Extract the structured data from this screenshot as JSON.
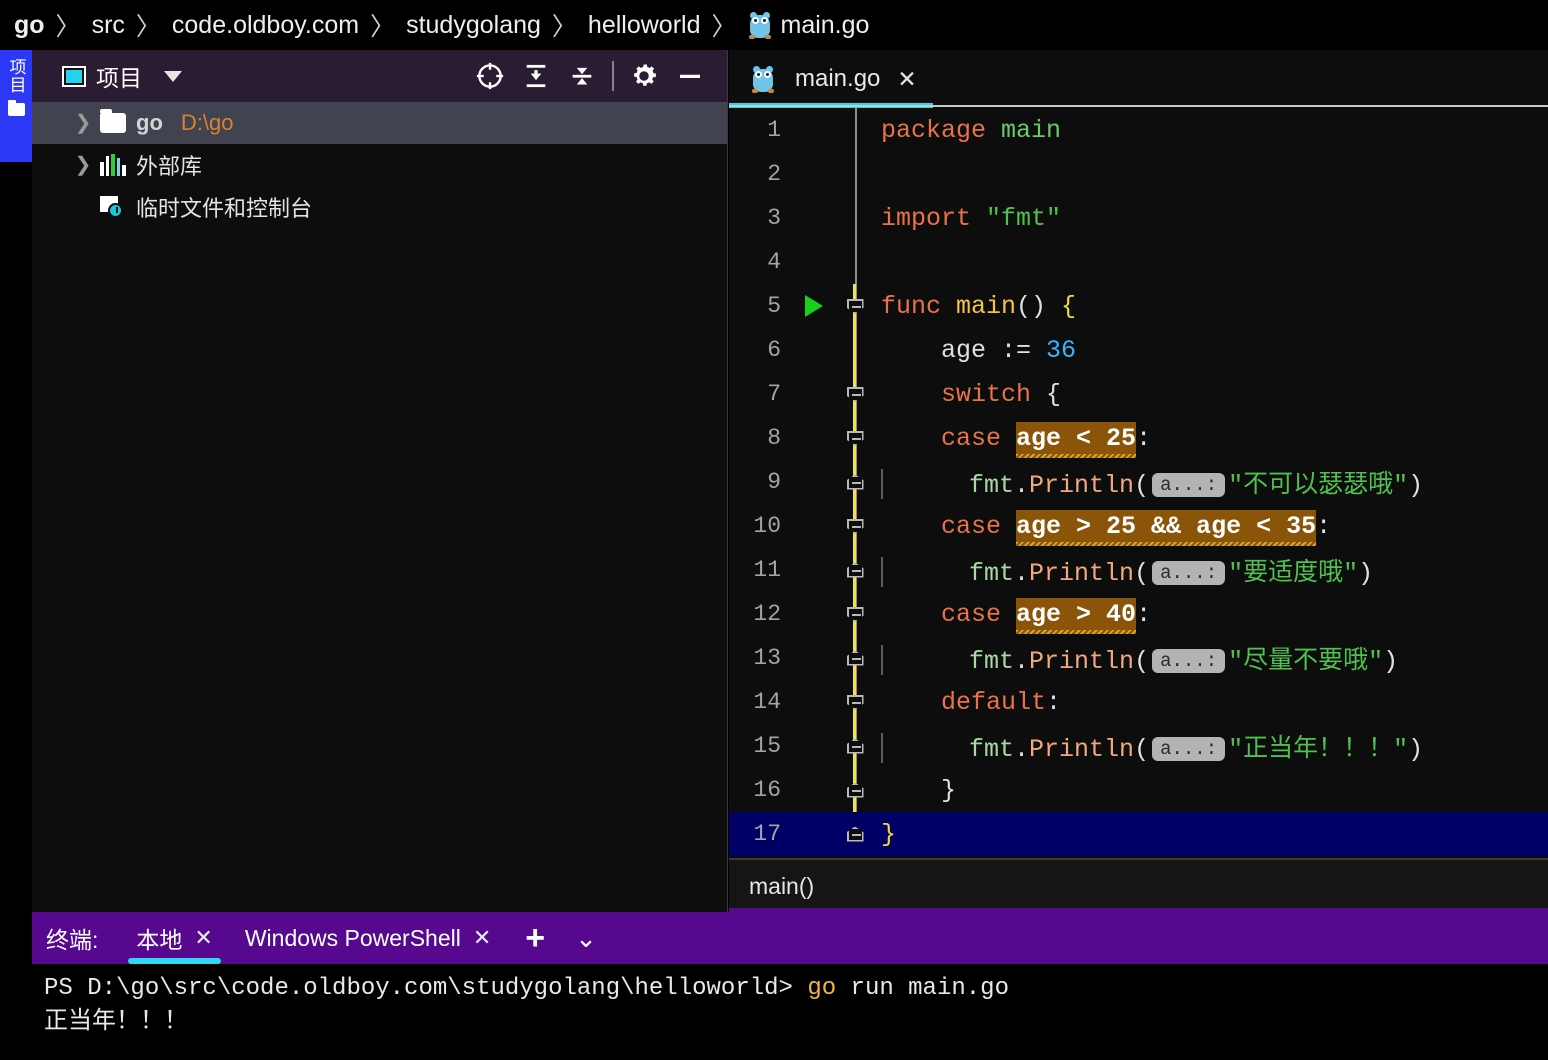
{
  "breadcrumb": {
    "items": [
      "go",
      "src",
      "code.oldboy.com",
      "studygolang",
      "helloworld",
      "main.go"
    ],
    "separator": "〉",
    "file_icon": "gopher-icon"
  },
  "rail": {
    "label": "项目",
    "folder_icon": "folder-icon",
    "accent_color": "#2b38f5"
  },
  "project_panel": {
    "title": "项目",
    "dropdown_icon": "chevron-down-icon",
    "toolbar_buttons": [
      {
        "name": "locate-icon",
        "tooltip": "定位"
      },
      {
        "name": "expand-all-icon",
        "tooltip": "全部展开"
      },
      {
        "name": "collapse-all-icon",
        "tooltip": "全部折叠"
      },
      {
        "name": "gear-icon",
        "tooltip": "设置"
      },
      {
        "name": "minimize-icon",
        "tooltip": "隐藏"
      }
    ],
    "tree": [
      {
        "label": "go",
        "path": "D:\\go",
        "icon": "folder-icon",
        "expandable": true,
        "selected": true,
        "bold": true
      },
      {
        "label": "外部库",
        "path": "",
        "icon": "library-icon",
        "expandable": true,
        "selected": false,
        "bold": false
      },
      {
        "label": "临时文件和控制台",
        "path": "",
        "icon": "scratches-icon",
        "expandable": false,
        "selected": false,
        "bold": false
      }
    ]
  },
  "editor": {
    "tab": {
      "label": "main.go",
      "icon": "gopher-icon",
      "close_icon": "close-icon",
      "active": true
    },
    "status_text": "main()",
    "current_line": 17,
    "run_marker_line": 5,
    "lines": [
      {
        "n": 1,
        "indent": 0,
        "segments": [
          {
            "t": "package ",
            "c": "kw"
          },
          {
            "t": "main",
            "c": "pkg"
          }
        ]
      },
      {
        "n": 2,
        "indent": 0,
        "segments": []
      },
      {
        "n": 3,
        "indent": 0,
        "segments": [
          {
            "t": "import ",
            "c": "kw"
          },
          {
            "t": "\"fmt\"",
            "c": "str"
          }
        ]
      },
      {
        "n": 4,
        "indent": 0,
        "segments": []
      },
      {
        "n": 5,
        "indent": 0,
        "segments": [
          {
            "t": "func ",
            "c": "kw"
          },
          {
            "t": "main",
            "c": "fn"
          },
          {
            "t": "() ",
            "c": "ident"
          },
          {
            "t": "{",
            "c": "brace"
          }
        ]
      },
      {
        "n": 6,
        "indent": 1,
        "segments": [
          {
            "t": "age := ",
            "c": "ident"
          },
          {
            "t": "36",
            "c": "num"
          }
        ]
      },
      {
        "n": 7,
        "indent": 1,
        "segments": [
          {
            "t": "switch ",
            "c": "kw"
          },
          {
            "t": "{",
            "c": "ident"
          }
        ]
      },
      {
        "n": 8,
        "indent": 1,
        "segments": [
          {
            "t": "case ",
            "c": "kw"
          },
          {
            "t": "age < 25",
            "c": "hl"
          },
          {
            "t": ":",
            "c": "ident"
          }
        ]
      },
      {
        "n": 9,
        "indent": 2,
        "segments": [
          {
            "t": "fmt",
            "c": "fmt"
          },
          {
            "t": ".",
            "c": "ident"
          },
          {
            "t": "Println",
            "c": "call"
          },
          {
            "t": "(",
            "c": "ident"
          },
          {
            "t": "a...:",
            "c": "chip"
          },
          {
            "t": "\"不可以瑟瑟哦\"",
            "c": "str"
          },
          {
            "t": ")",
            "c": "ident"
          }
        ]
      },
      {
        "n": 10,
        "indent": 1,
        "segments": [
          {
            "t": "case ",
            "c": "kw"
          },
          {
            "t": "age > 25 && age < 35",
            "c": "hl"
          },
          {
            "t": ":",
            "c": "ident"
          }
        ]
      },
      {
        "n": 11,
        "indent": 2,
        "segments": [
          {
            "t": "fmt",
            "c": "fmt"
          },
          {
            "t": ".",
            "c": "ident"
          },
          {
            "t": "Println",
            "c": "call"
          },
          {
            "t": "(",
            "c": "ident"
          },
          {
            "t": "a...:",
            "c": "chip"
          },
          {
            "t": "\"要适度哦\"",
            "c": "str"
          },
          {
            "t": ")",
            "c": "ident"
          }
        ]
      },
      {
        "n": 12,
        "indent": 1,
        "segments": [
          {
            "t": "case ",
            "c": "kw"
          },
          {
            "t": "age > 40",
            "c": "hl"
          },
          {
            "t": ":",
            "c": "ident"
          }
        ]
      },
      {
        "n": 13,
        "indent": 2,
        "segments": [
          {
            "t": "fmt",
            "c": "fmt"
          },
          {
            "t": ".",
            "c": "ident"
          },
          {
            "t": "Println",
            "c": "call"
          },
          {
            "t": "(",
            "c": "ident"
          },
          {
            "t": "a...:",
            "c": "chip"
          },
          {
            "t": "\"尽量不要哦\"",
            "c": "str"
          },
          {
            "t": ")",
            "c": "ident"
          }
        ]
      },
      {
        "n": 14,
        "indent": 1,
        "segments": [
          {
            "t": "default",
            "c": "kw"
          },
          {
            "t": ":",
            "c": "ident"
          }
        ]
      },
      {
        "n": 15,
        "indent": 2,
        "segments": [
          {
            "t": "fmt",
            "c": "fmt"
          },
          {
            "t": ".",
            "c": "ident"
          },
          {
            "t": "Println",
            "c": "call"
          },
          {
            "t": "(",
            "c": "ident"
          },
          {
            "t": "a...:",
            "c": "chip"
          },
          {
            "t": "\"正当年！！！\"",
            "c": "str"
          },
          {
            "t": ")",
            "c": "ident"
          }
        ]
      },
      {
        "n": 16,
        "indent": 1,
        "segments": [
          {
            "t": "}",
            "c": "ident"
          }
        ]
      },
      {
        "n": 17,
        "indent": 0,
        "segments": [
          {
            "t": "}",
            "c": "brace"
          }
        ]
      }
    ]
  },
  "terminal": {
    "label": "终端:",
    "tabs": [
      {
        "label": "本地",
        "active": true,
        "close_icon": "close-icon"
      },
      {
        "label": "Windows PowerShell",
        "active": false,
        "close_icon": "close-icon"
      }
    ],
    "add_icon": "plus-icon",
    "dropdown_icon": "chevron-down-icon",
    "prompt": "PS D:\\go\\src\\code.oldboy.com\\studygolang\\helloworld> ",
    "command_keyword": "go",
    "command_rest": " run main.go",
    "output": "正当年！！！"
  },
  "colors": {
    "toolbar_bg": "#2a1d33",
    "terminal_bg": "#56088f",
    "accent_cyan": "#28d7f0",
    "rail_blue": "#2b38f5",
    "current_line": "#000066",
    "highlight_amber": "#8a5508",
    "tree_selected": "#414350"
  }
}
